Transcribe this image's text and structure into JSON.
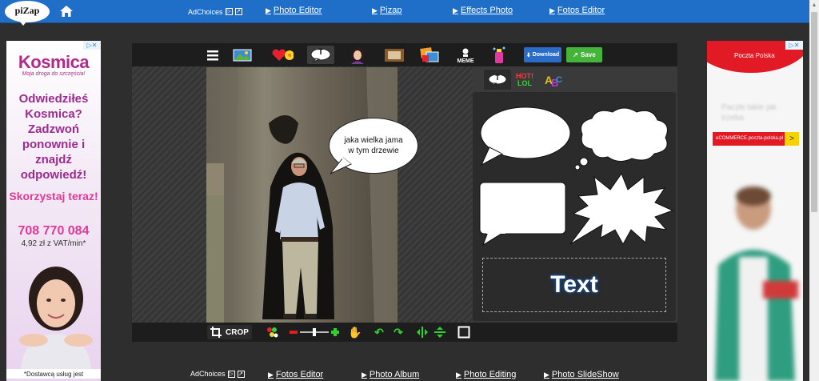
{
  "topbar": {
    "logo_text": "piZap",
    "adchoices": "AdChoices",
    "links": [
      {
        "label": "Photo Editor"
      },
      {
        "label": "Pizap"
      },
      {
        "label": "Effects Photo"
      },
      {
        "label": "Fotos Editor"
      }
    ]
  },
  "bottombar": {
    "adchoices": "AdChoices",
    "links": [
      {
        "label": "Fotos Editor"
      },
      {
        "label": "Photo Album"
      },
      {
        "label": "Photo Editing"
      },
      {
        "label": "Photo SlideShow"
      }
    ]
  },
  "left_ad": {
    "brand": "Kosmica",
    "tagline": "Moja droga do szczęścia!",
    "question": "Odwiedziłeś Kosmica? Zadzwoń ponownie i znajdź odpowiedź!",
    "cta": "Skorzystaj teraz!",
    "phone": "708 770 084",
    "price": "4,92 zł z VAT/min*",
    "note": "*Dostawcą usług jest"
  },
  "right_ad": {
    "brand": "Poczta Polska",
    "blurred_text": "Paczki takie jak trzeba",
    "bar_text": "eCOMMERCE.poczta-polska.pl",
    "bar_arrow": ">"
  },
  "editor": {
    "toolbar": {
      "text_tool_letter": "T",
      "meme_label": "MEME",
      "download_label": "Download",
      "save_label": "Save"
    },
    "bubble_text": "jaka wielka jama w tym drzewie",
    "bottom": {
      "crop_label": "CROP",
      "zoom_level": 0.5
    },
    "panel": {
      "tab_text_letter": "T",
      "tab_hot_top": "HOT!",
      "tab_hot_bottom": "LOL",
      "text_sample": "Text"
    }
  },
  "colors": {
    "topbar": "#1f6fc9",
    "save": "#45b43a",
    "download": "#2c6cc9",
    "minus": "#e02020",
    "plus": "#2fd12f"
  }
}
